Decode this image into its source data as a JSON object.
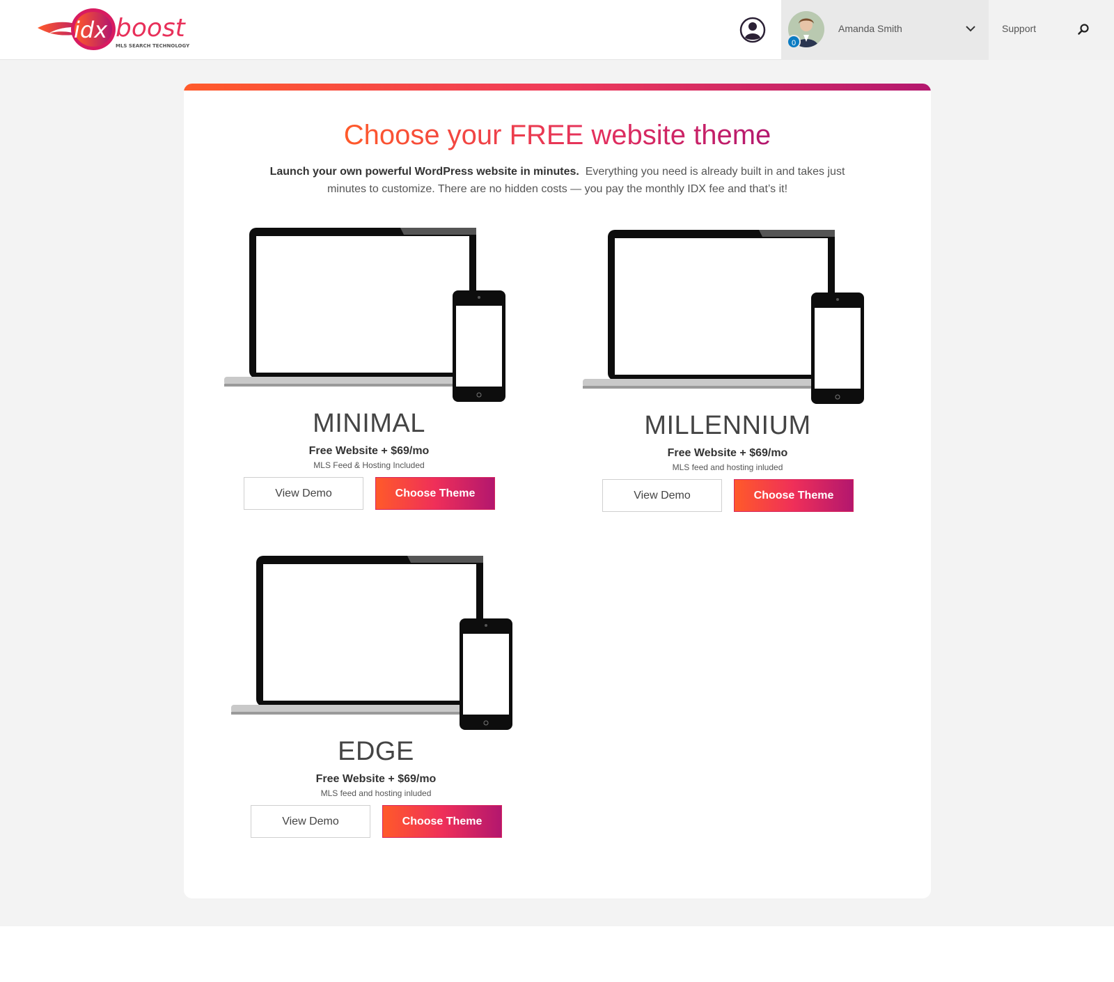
{
  "header": {
    "logo_text": "idxboost",
    "logo_tagline": "MLS SEARCH TECHNOLOGY",
    "user": {
      "name": "Amanda Smith",
      "notification_count": "0"
    },
    "support_label": "Support"
  },
  "main": {
    "title": "Choose your FREE website theme",
    "intro_bold": "Launch your own powerful WordPress website in minutes.",
    "intro_text": "Everything you need is already built in and takes just minutes to customize. There are no hidden costs — you pay the monthly IDX fee and that’s it!",
    "themes": [
      {
        "name": "MINIMAL",
        "price": "Free Website + $69/mo",
        "note": "MLS Feed & Hosting Included",
        "demo_label": "View Demo",
        "choose_label": "Choose Theme"
      },
      {
        "name": "MILLENNIUM",
        "price": "Free Website + $69/mo",
        "note": "MLS feed and hosting inluded",
        "demo_label": "View Demo",
        "choose_label": "Choose Theme"
      },
      {
        "name": "EDGE",
        "price": "Free Website + $69/mo",
        "note": "MLS feed and hosting inluded",
        "demo_label": "View Demo",
        "choose_label": "Choose Theme"
      }
    ]
  },
  "colors": {
    "accent_orange": "#ff5a2a",
    "accent_magenta": "#b3176e",
    "badge_blue": "#0a7bc2",
    "page_gray": "#f3f3f3"
  }
}
